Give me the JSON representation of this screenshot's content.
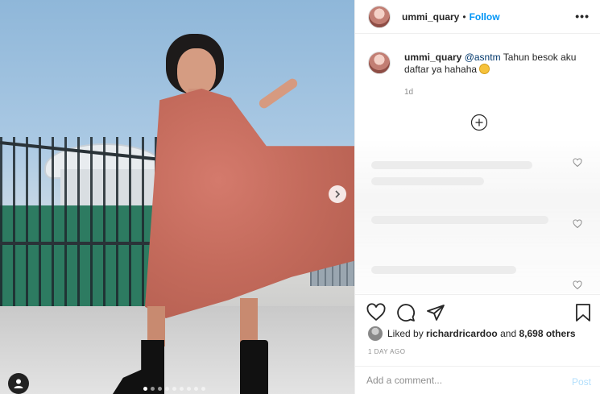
{
  "post": {
    "username": "ummi_quary",
    "separator": "•",
    "follow_label": "Follow",
    "more_label": "•••"
  },
  "photo": {
    "carousel_dots": 9,
    "active_dot": 1
  },
  "comment": {
    "username": "ummi_quary",
    "mention": "@asntm",
    "text": "Tahun besok aku daftar ya hahaha",
    "emoji_icon": "grinning-face-icon",
    "age": "1d"
  },
  "likes": {
    "prefix": "Liked by",
    "user": "richardricardoo",
    "and": "and",
    "others": "8,698 others"
  },
  "timestamp": "1 DAY AGO",
  "add_comment": {
    "placeholder": "Add a comment...",
    "post_label": "Post"
  },
  "colors": {
    "accent": "#0095f6",
    "post_disabled": "#b2dffc",
    "muted": "#8e8e8e"
  }
}
